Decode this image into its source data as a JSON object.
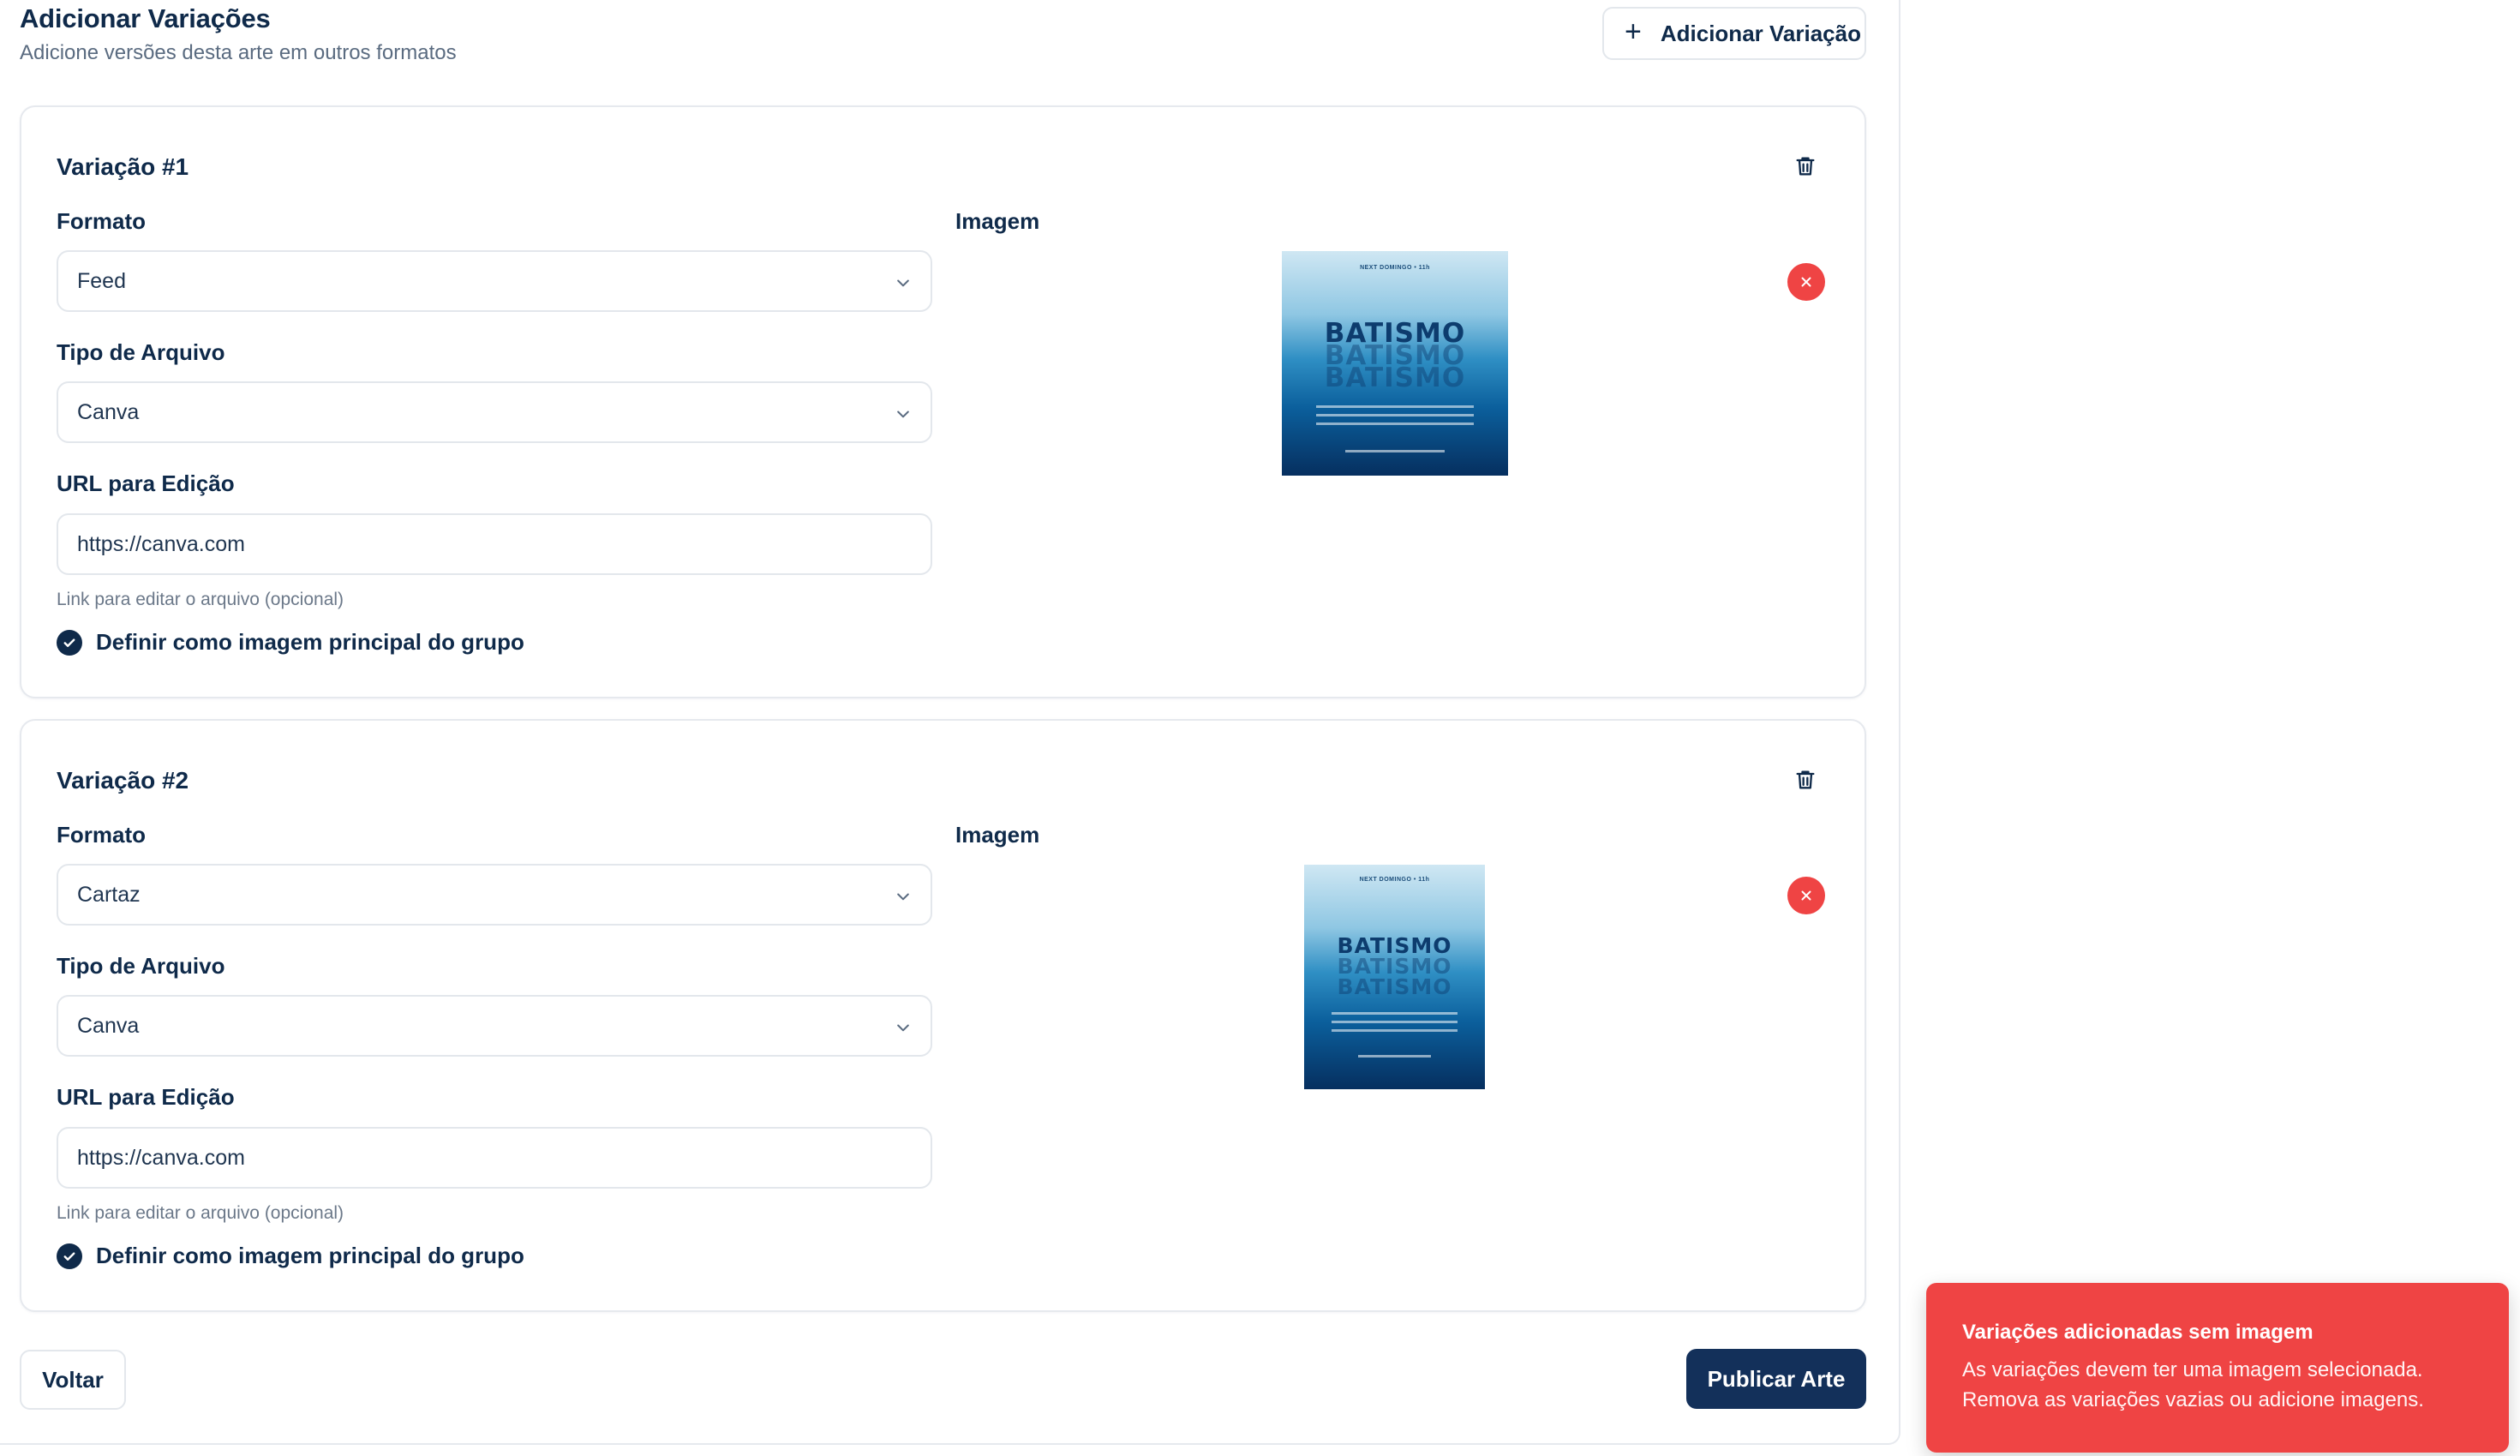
{
  "header": {
    "title": "Adicionar Variações",
    "subtitle": "Adicione versões desta arte em outros formatos",
    "add_button": "Adicionar Variação"
  },
  "variations": [
    {
      "title": "Variação #1",
      "format_label": "Formato",
      "format_value": "Feed",
      "file_type_label": "Tipo de Arquivo",
      "file_type_value": "Canva",
      "url_label": "URL para Edição",
      "url_value": "https://canva.com",
      "url_hint": "Link para editar o arquivo (opcional)",
      "main_image_label": "Definir como imagem principal do grupo",
      "image_label": "Imagem",
      "image_word": "BATISMO"
    },
    {
      "title": "Variação #2",
      "format_label": "Formato",
      "format_value": "Cartaz",
      "file_type_label": "Tipo de Arquivo",
      "file_type_value": "Canva",
      "url_label": "URL para Edição",
      "url_value": "https://canva.com",
      "url_hint": "Link para editar o arquivo (opcional)",
      "main_image_label": "Definir como imagem principal do grupo",
      "image_label": "Imagem",
      "image_word": "BATISMO"
    }
  ],
  "footer": {
    "back_button": "Voltar",
    "publish_button": "Publicar Arte"
  },
  "toast": {
    "title": "Variações adicionadas sem imagem",
    "line1": "As variações devem ter uma imagem selecionada.",
    "line2": "Remova as variações vazias ou adicione imagens."
  },
  "colors": {
    "primary": "#13305a",
    "danger": "#ef4444",
    "border": "#e3e7ec"
  }
}
